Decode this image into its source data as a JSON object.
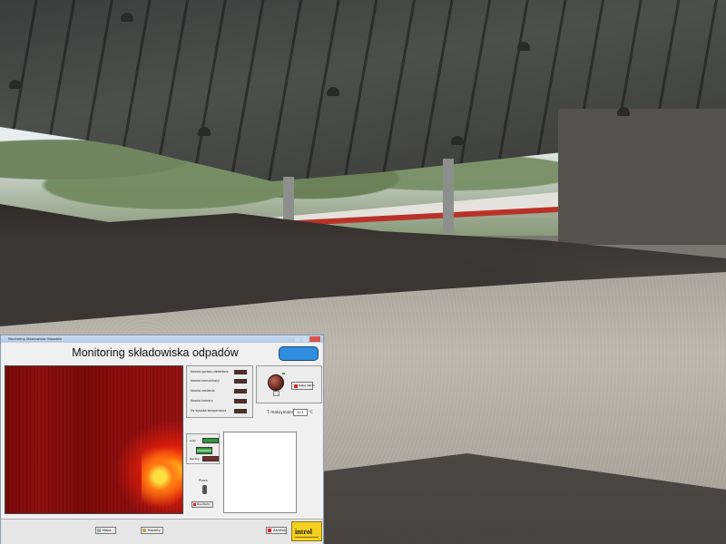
{
  "window": {
    "title": "Monitoring Składowiska Odpadów",
    "app_title": "Monitoring składowiska odpadów",
    "status_led_color": "#2f8de0"
  },
  "status_panel": {
    "items": [
      {
        "label": "Awaria sprzętu detektora",
        "state": "off"
      },
      {
        "label": "Awaria komunikacji",
        "state": "off"
      },
      {
        "label": "Awaria zasilania",
        "state": "off"
      },
      {
        "label": "Awaria kamery",
        "state": "off"
      },
      {
        "label": "Za wysoka temperatura",
        "state": "off"
      }
    ]
  },
  "alarm_panel": {
    "ack_button": "Kasuj alarm",
    "temp_label": "T. maksymalna",
    "temp_value": "22.1",
    "temp_unit": "°C"
  },
  "switch_panel": {
    "row1_label": "Auto",
    "row2_label": "Ręczny",
    "control_label": "Praca",
    "action_button": "Uruchom"
  },
  "bottom_bar": {
    "buttons": [
      "Mapa",
      "Raporty",
      "Zamknij"
    ],
    "logo_text": "introl"
  },
  "colors": {
    "alarm_red": "#d8282a",
    "indicator_green": "#2e9b3a",
    "indicator_off": "#5a2a24",
    "thermal_low": "#7a0a0a",
    "thermal_high": "#ffcc22"
  }
}
